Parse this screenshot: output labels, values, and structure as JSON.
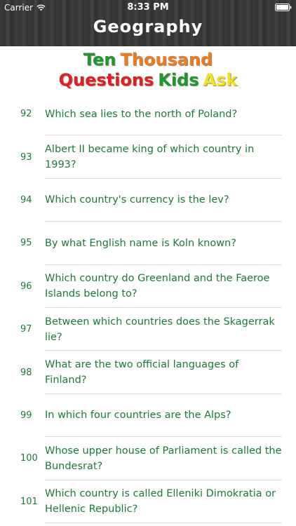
{
  "status": {
    "carrier": "Carrier",
    "time": "8:33 PM"
  },
  "header": {
    "title": "Geography"
  },
  "banner": {
    "line1": [
      {
        "text": "Ten",
        "color": "#1f9a2a"
      },
      {
        "text": "Thousand",
        "color": "#f07a1c"
      }
    ],
    "line2": [
      {
        "text": "Questions",
        "color": "#e81c1c"
      },
      {
        "text": "Kids",
        "color": "#1f9a2a"
      },
      {
        "text": "Ask",
        "color": "#f2e11c"
      }
    ]
  },
  "questions": [
    {
      "number": "92",
      "text": "Which sea lies to the north of Poland?"
    },
    {
      "number": "93",
      "text": "Albert II became king of which country in 1993?"
    },
    {
      "number": "94",
      "text": "Which country's currency is the lev?"
    },
    {
      "number": "95",
      "text": "By what English name is Koln known?"
    },
    {
      "number": "96",
      "text": "Which country do Greenland and the Faeroe Islands belong to?"
    },
    {
      "number": "97",
      "text": "Between which countries does the Skagerrak lie?"
    },
    {
      "number": "98",
      "text": "What are the two official languages of Finland?"
    },
    {
      "number": "99",
      "text": "In which four countries are the Alps?"
    },
    {
      "number": "100",
      "text": "Whose upper house of Parliament is called the Bundesrat?"
    },
    {
      "number": "101",
      "text": "Which country is called Elleniki Dimokratia or Hellenic Republic?"
    }
  ]
}
